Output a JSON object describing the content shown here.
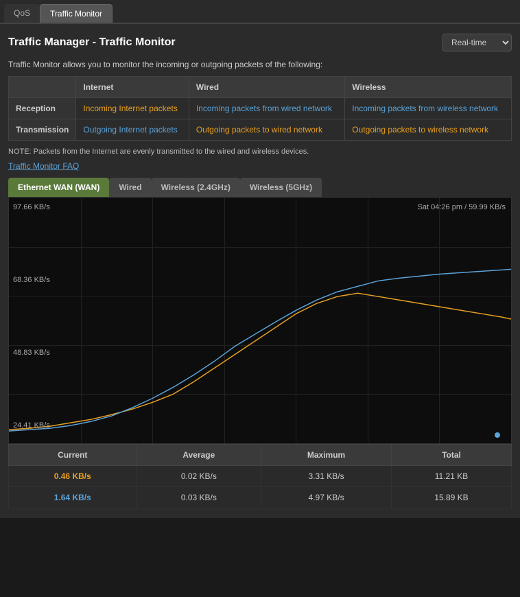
{
  "tabs": [
    {
      "id": "qos",
      "label": "QoS",
      "active": false
    },
    {
      "id": "traffic-monitor",
      "label": "Traffic Monitor",
      "active": true
    }
  ],
  "header": {
    "title": "Traffic Manager - Traffic Monitor",
    "realtime_label": "Real-time"
  },
  "description": "Traffic Monitor allows you to monitor the incoming or outgoing packets of the following:",
  "info_table": {
    "columns": [
      "",
      "Internet",
      "Wired",
      "Wireless"
    ],
    "rows": [
      {
        "label": "Reception",
        "internet": "Incoming Internet packets",
        "internet_color": "orange",
        "wired": "Incoming packets from wired network",
        "wired_color": "blue",
        "wireless": "Incoming packets from wireless network",
        "wireless_color": "blue"
      },
      {
        "label": "Transmission",
        "internet": "Outgoing Internet packets",
        "internet_color": "blue",
        "wired": "Outgoing packets to wired network",
        "wired_color": "orange",
        "wireless": "Outgoing packets to wireless network",
        "wireless_color": "orange"
      }
    ]
  },
  "note": "NOTE: Packets from the Internet are evenly transmitted to the wired and wireless devices.",
  "faq_link": "Traffic Monitor FAQ",
  "monitor_tabs": [
    {
      "label": "Ethernet WAN (WAN)",
      "active": true
    },
    {
      "label": "Wired",
      "active": false
    },
    {
      "label": "Wireless (2.4GHz)",
      "active": false
    },
    {
      "label": "Wireless (5GHz)",
      "active": false
    }
  ],
  "chart": {
    "y_labels": [
      "97.66 KB/s",
      "68.36 KB/s",
      "48.83 KB/s",
      "24.41 KB/s"
    ],
    "timestamp": "Sat 04:26 pm / 59.99 KB/s"
  },
  "stats": {
    "headers": [
      "Current",
      "Average",
      "Maximum",
      "Total"
    ],
    "rows": [
      {
        "current": "0.46 KB/s",
        "current_color": "orange",
        "average": "0.02 KB/s",
        "maximum": "3.31 KB/s",
        "total": "11.21 KB"
      },
      {
        "current": "1.64 KB/s",
        "current_color": "blue",
        "average": "0.03 KB/s",
        "maximum": "4.97 KB/s",
        "total": "15.89 KB"
      }
    ]
  }
}
